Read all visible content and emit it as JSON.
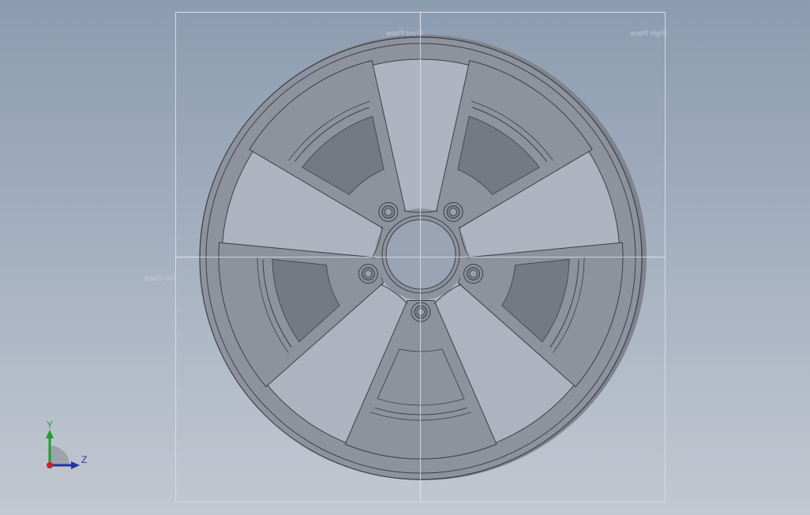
{
  "viewport": {
    "background_top": "#8c9bb0",
    "background_bottom": "#c2c8d1",
    "model_color": "#8d929c"
  },
  "planes": {
    "front_label": "Front Plane",
    "right_label": "Right Plane",
    "top_label": "Top Plane"
  },
  "triad": {
    "y_label": "Y",
    "z_label": "Z",
    "y_color": "#1f9d2a",
    "z_color": "#2233aa",
    "x_color": "#cc2222"
  },
  "model": {
    "name": "wheel-rim",
    "spoke_count": 5,
    "bolt_hole_count": 5
  }
}
